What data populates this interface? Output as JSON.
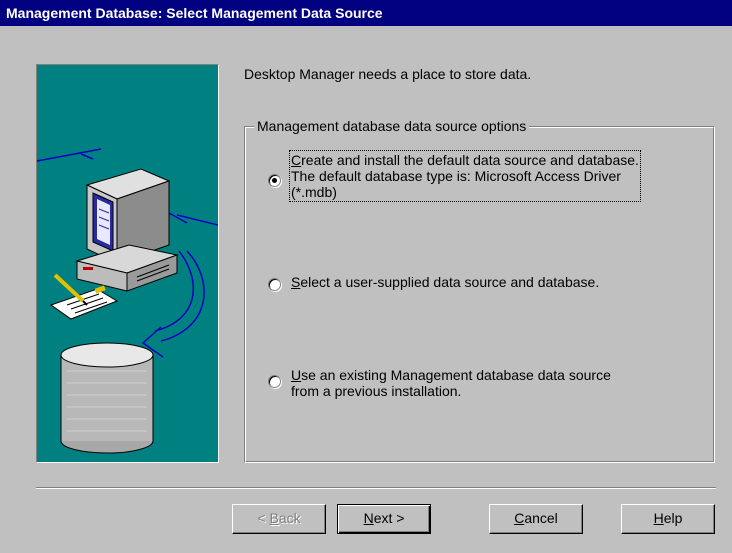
{
  "window": {
    "title": "Management Database: Select Management Data Source"
  },
  "intro_text": "Desktop Manager needs a place to store data.",
  "group": {
    "legend": "Management database data source options",
    "options": [
      {
        "mnemonic": "C",
        "rest": "reate and install the default data source and database.\nThe default database type is: Microsoft Access Driver\n(*.mdb)",
        "selected": true
      },
      {
        "mnemonic": "S",
        "rest": "elect a user-supplied data source and database.",
        "selected": false
      },
      {
        "mnemonic": "U",
        "rest": "se an existing Management database data source\nfrom a previous installation.",
        "selected": false
      }
    ]
  },
  "buttons": {
    "back": {
      "pre": "< ",
      "mnemonic": "B",
      "post": "ack",
      "enabled": false
    },
    "next": {
      "pre": "",
      "mnemonic": "N",
      "post": "ext >",
      "enabled": true
    },
    "cancel": {
      "pre": "",
      "mnemonic": "C",
      "post": "ancel",
      "enabled": true
    },
    "help": {
      "pre": "",
      "mnemonic": "H",
      "post": "elp",
      "enabled": true
    }
  },
  "colors": {
    "titlebar": "#000080",
    "art_background": "#008080",
    "dialog_face": "#c0c0c0"
  },
  "illustration": {
    "icons": [
      "computer-icon",
      "notepad-icon",
      "pencil-icon",
      "database-cylinder-icon",
      "blue-arrow-icon"
    ]
  }
}
